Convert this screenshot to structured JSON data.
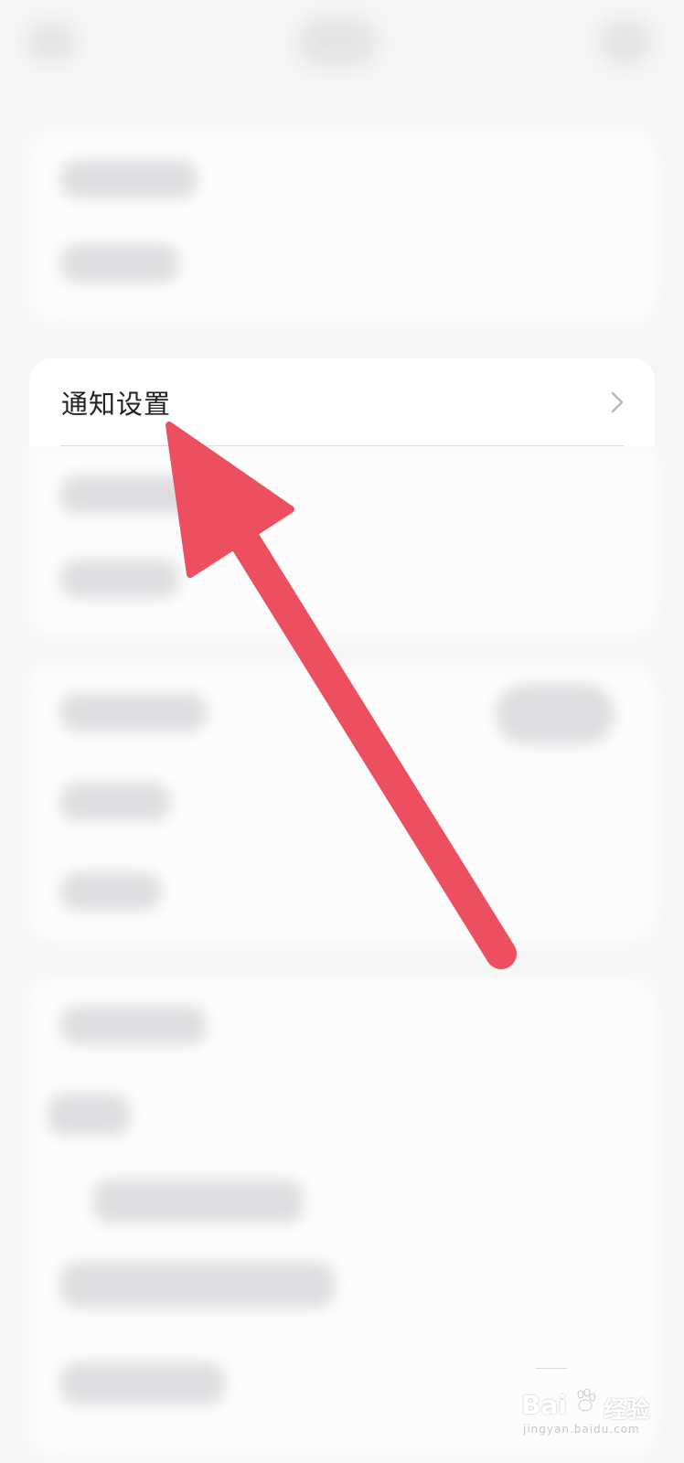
{
  "settings": {
    "notification_settings_label": "通知设置"
  },
  "icons": {
    "row_chevron": "chevron-right-icon",
    "callout_arrow": "red-arrow-icon",
    "watermark_paw": "paw-icon"
  },
  "annotation": {
    "arrow_color": "#ec5060"
  },
  "watermark": {
    "brand": "Bai",
    "title": "经验",
    "url": "jingyan.baidu.com"
  },
  "colors": {
    "background": "#f6f6f7",
    "card": "#ffffff",
    "primary_text": "#222222",
    "chevron": "#b8b8bc",
    "divider": "#dddddf"
  }
}
